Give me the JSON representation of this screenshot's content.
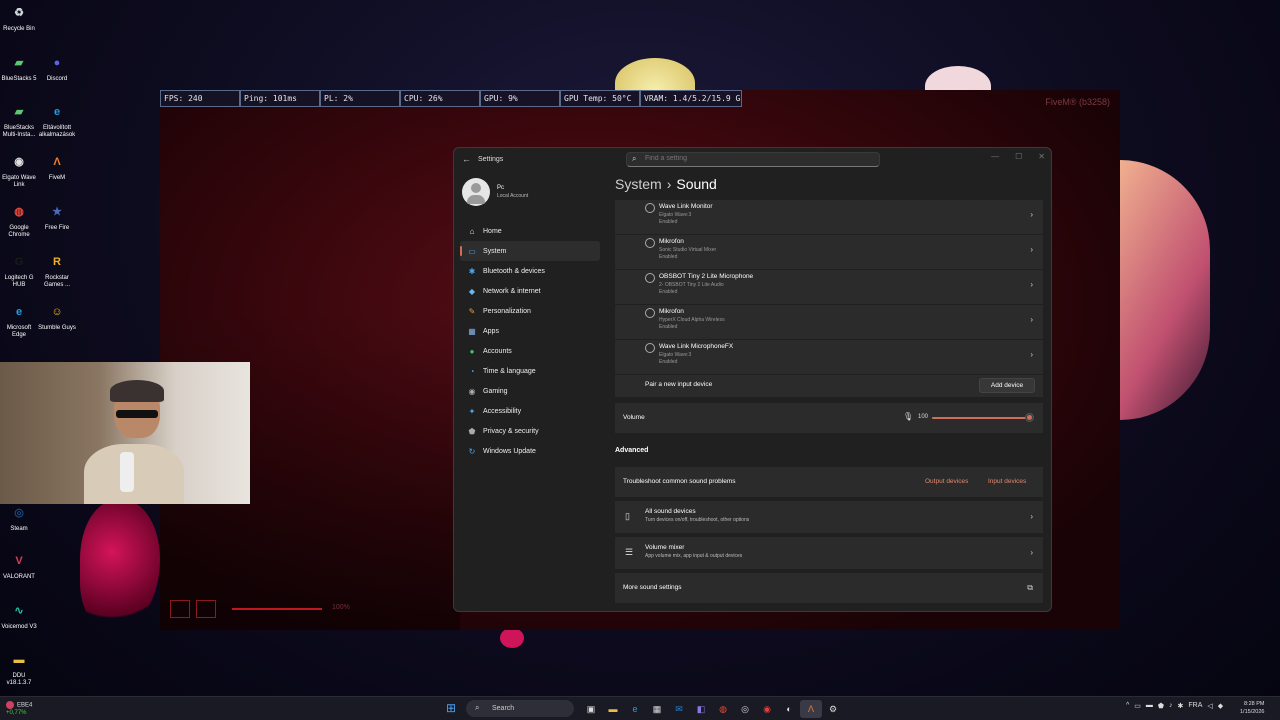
{
  "stats": {
    "fps": "FPS: 240",
    "ping": "Ping: 101ms",
    "pl": "PL: 2%",
    "cpu": "CPU: 26%",
    "gpu": "GPU: 9%",
    "gpu_temp": "GPU Temp: 50°C",
    "vram": "VRAM: 1.4/5.2/15.9 GB"
  },
  "game": {
    "title": "FiveM® (b3258)",
    "hud_pct": "100%"
  },
  "desktop_icons": [
    {
      "label": "Recycle Bin",
      "icon": "recycle-bin-icon",
      "glyph": "♻",
      "color": "#d0d8e0"
    },
    {
      "label": "BlueStacks 5",
      "icon": "bluestacks-icon",
      "glyph": "▰",
      "color": "#5cc870"
    },
    {
      "label": "Discord",
      "icon": "discord-icon",
      "glyph": "●",
      "color": "#5865f2"
    },
    {
      "label": "BlueStacks Multi-Insta...",
      "icon": "bluestacks-multi-icon",
      "glyph": "▰",
      "color": "#5cc870"
    },
    {
      "label": "Eltávolított alkalmazások",
      "icon": "edge-icon",
      "glyph": "e",
      "color": "#1fa0e0"
    },
    {
      "label": "Elgato Wave Link",
      "icon": "elgato-icon",
      "glyph": "◉",
      "color": "#e0e0e0"
    },
    {
      "label": "FiveM",
      "icon": "fivem-icon",
      "glyph": "Λ",
      "color": "#f07a30"
    },
    {
      "label": "Google Chrome",
      "icon": "chrome-icon",
      "glyph": "◍",
      "color": "#e84a3a"
    },
    {
      "label": "Free Fire",
      "icon": "freefire-icon",
      "glyph": "★",
      "color": "#4a6ac0"
    },
    {
      "label": "Logitech G HUB",
      "icon": "logitech-icon",
      "glyph": "G",
      "color": "#1a1a1a"
    },
    {
      "label": "Rockstar Games ...",
      "icon": "rockstar-icon",
      "glyph": "R",
      "color": "#f0b020"
    },
    {
      "label": "Microsoft Edge",
      "icon": "edge-icon",
      "glyph": "e",
      "color": "#1fa0e0"
    },
    {
      "label": "Stumble Guys",
      "icon": "stumble-guys-icon",
      "glyph": "☺",
      "color": "#f0c020"
    },
    {
      "label": "Steam",
      "icon": "steam-icon",
      "glyph": "◎",
      "color": "#1b4a80"
    },
    {
      "label": "VALORANT",
      "icon": "valorant-icon",
      "glyph": "V",
      "color": "#d04050"
    },
    {
      "label": "Voicemod V3",
      "icon": "voicemod-icon",
      "glyph": "∿",
      "color": "#20c0a0"
    },
    {
      "label": "DDU v18.1.3.7",
      "icon": "folder-icon",
      "glyph": "▬",
      "color": "#e8c040"
    }
  ],
  "settings": {
    "app_title": "Settings",
    "search_placeholder": "Find a setting",
    "profile_name": "Pc",
    "profile_sub": "Local Account",
    "breadcrumb_parent": "System",
    "breadcrumb_current": "Sound",
    "nav": [
      {
        "label": "Home",
        "icon": "home-icon",
        "glyph": "⌂",
        "color": "#e0e0e0"
      },
      {
        "label": "System",
        "icon": "system-icon",
        "glyph": "▭",
        "color": "#4aa8f0"
      },
      {
        "label": "Bluetooth & devices",
        "icon": "bluetooth-icon",
        "glyph": "✱",
        "color": "#4aa8f0"
      },
      {
        "label": "Network & internet",
        "icon": "wifi-icon",
        "glyph": "◆",
        "color": "#6ab8f0"
      },
      {
        "label": "Personalization",
        "icon": "brush-icon",
        "glyph": "✎",
        "color": "#e0a040"
      },
      {
        "label": "Apps",
        "icon": "apps-icon",
        "glyph": "▦",
        "color": "#8ab0e0"
      },
      {
        "label": "Accounts",
        "icon": "accounts-icon",
        "glyph": "●",
        "color": "#40c070"
      },
      {
        "label": "Time & language",
        "icon": "time-language-icon",
        "glyph": "◔",
        "color": "#4aa8f0"
      },
      {
        "label": "Gaming",
        "icon": "gaming-icon",
        "glyph": "◉",
        "color": "#aaaaaa"
      },
      {
        "label": "Accessibility",
        "icon": "accessibility-icon",
        "glyph": "✦",
        "color": "#4aa8f0"
      },
      {
        "label": "Privacy & security",
        "icon": "shield-icon",
        "glyph": "⬟",
        "color": "#aaaaaa"
      },
      {
        "label": "Windows Update",
        "icon": "windows-update-icon",
        "glyph": "↻",
        "color": "#4aa8f0"
      }
    ],
    "active_nav": "System",
    "input_devices": [
      {
        "name": "Wave Link Monitor",
        "sub": "Elgato Wave:3",
        "status": "Enabled"
      },
      {
        "name": "Mikrofon",
        "sub": "Sonic Studio Virtual Mixer",
        "status": "Enabled"
      },
      {
        "name": "OBSBOT Tiny 2 Lite Microphone",
        "sub": "2- OBSBOT Tiny 2 Lite Audio",
        "status": "Enabled"
      },
      {
        "name": "Mikrofon",
        "sub": "HyperX Cloud Alpha Wireless",
        "status": "Enabled"
      },
      {
        "name": "Wave Link MicrophoneFX",
        "sub": "Elgato Wave:3",
        "status": "Enabled"
      }
    ],
    "pair_label": "Pair a new input device",
    "add_device": "Add device",
    "volume_label": "Volume",
    "volume_value": "100",
    "volume_level": 1.0,
    "advanced_title": "Advanced",
    "troubleshoot_label": "Troubleshoot common sound problems",
    "output_devices_link": "Output devices",
    "input_devices_link": "Input devices",
    "all_devices_title": "All sound devices",
    "all_devices_sub": "Turn devices on/off, troubleshoot, other options",
    "mixer_title": "Volume mixer",
    "mixer_sub": "App volume mix, app input & output devices",
    "more_settings": "More sound settings"
  },
  "taskbar": {
    "weather_title": "EBE4",
    "weather_change": "+0,77%",
    "search_label": "Search",
    "apps": [
      {
        "icon": "task-view-icon",
        "glyph": "▣",
        "color": "#ddd"
      },
      {
        "icon": "file-explorer-icon",
        "glyph": "▬",
        "color": "#e8c040"
      },
      {
        "icon": "edge-icon",
        "glyph": "e",
        "color": "#1fa0e0"
      },
      {
        "icon": "store-icon",
        "glyph": "▦",
        "color": "#ddd"
      },
      {
        "icon": "outlook-icon",
        "glyph": "✉",
        "color": "#2a80d0"
      },
      {
        "icon": "teams-icon",
        "glyph": "◧",
        "color": "#8a7ae0"
      },
      {
        "icon": "chrome-icon",
        "glyph": "◍",
        "color": "#e84a3a"
      },
      {
        "icon": "steam-icon",
        "glyph": "◎",
        "color": "#cfd8e0"
      },
      {
        "icon": "obs-icon",
        "glyph": "◉",
        "color": "#e04040"
      },
      {
        "icon": "media-icon",
        "glyph": "◐",
        "color": "#ddd"
      },
      {
        "icon": "fivem-icon",
        "glyph": "Λ",
        "color": "#f07a30"
      },
      {
        "icon": "settings-icon",
        "glyph": "⚙",
        "color": "#ddd"
      }
    ],
    "tray": [
      {
        "icon": "chevron-up-icon",
        "glyph": "^"
      },
      {
        "icon": "network-icon",
        "glyph": "▭"
      },
      {
        "icon": "folder-icon",
        "glyph": "▬"
      },
      {
        "icon": "shield-icon",
        "glyph": "⬟"
      },
      {
        "icon": "microphone-icon",
        "glyph": "♪"
      },
      {
        "icon": "bluetooth-icon",
        "glyph": "✱"
      },
      {
        "icon": "language-label",
        "glyph": "FRA"
      },
      {
        "icon": "volume-icon",
        "glyph": "◁"
      },
      {
        "icon": "wifi-icon",
        "glyph": "◆"
      }
    ],
    "time": "8:28 PM",
    "date": "1/15/2026"
  }
}
